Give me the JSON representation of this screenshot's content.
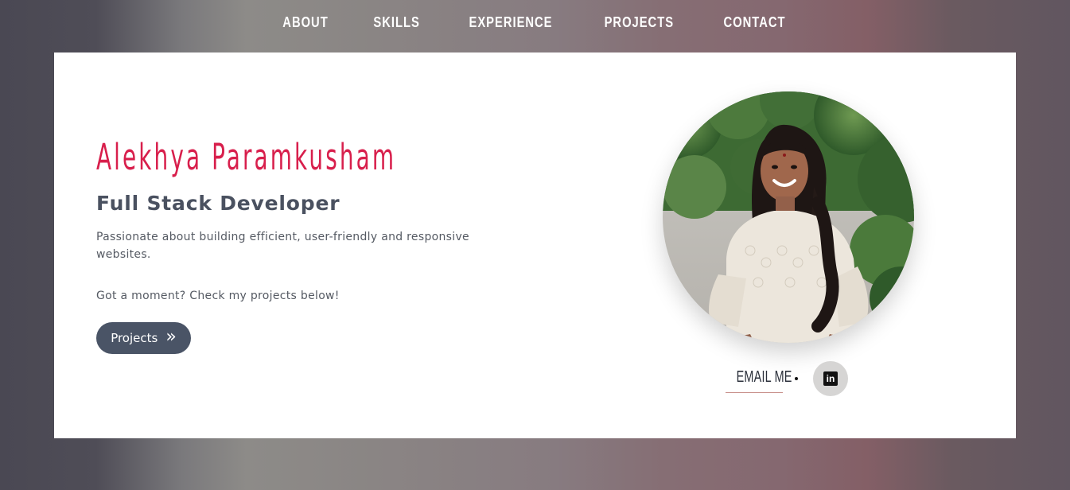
{
  "nav": {
    "items": [
      {
        "label": "ABOUT"
      },
      {
        "label": "SKILLS"
      },
      {
        "label": "EXPERIENCE"
      },
      {
        "label": "PROJECTS"
      },
      {
        "label": "CONTACT"
      }
    ]
  },
  "hero": {
    "name": "Alekhya Paramkusham",
    "role": "Full Stack Developer",
    "description": "Passionate about building efficient, user-friendly and responsive websites.",
    "cta_text": "Got a moment? Check my projects below!",
    "projects_button": "Projects",
    "projects_button_icon": "double-chevron-right-icon",
    "chevron_glyph": "»"
  },
  "contact": {
    "email_label": "EMAIL ME",
    "linkedin_icon": "linkedin-icon",
    "linkedin_glyph": "in"
  },
  "photo": {
    "icon": "profile-photo"
  },
  "colors": {
    "accent_name": "#d81f4c",
    "button_bg": "#4a5466",
    "text_dark": "#4a5160",
    "email_underline": "#c9938e",
    "linkedin_bg": "#d6d5d4"
  }
}
